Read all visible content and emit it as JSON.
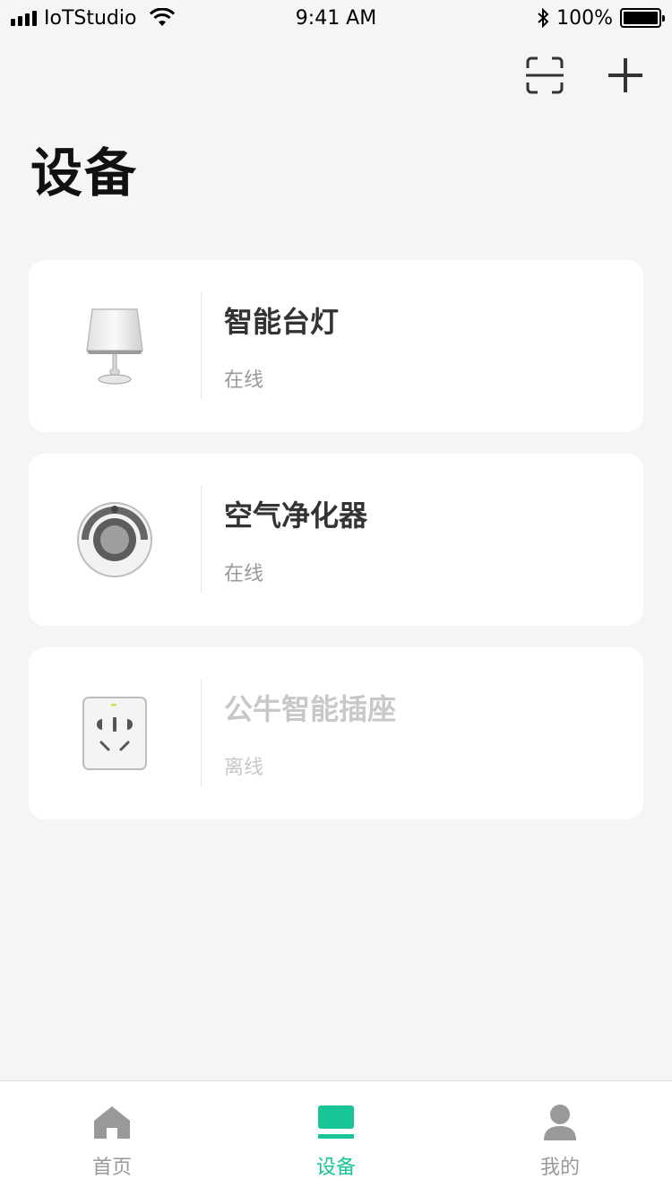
{
  "status_bar": {
    "carrier": "IoTStudio",
    "time": "9:41 AM",
    "battery": "100%",
    "icons": [
      "signal-icon",
      "wifi-icon",
      "bluetooth-icon",
      "battery-icon"
    ]
  },
  "header": {
    "title": "设备",
    "actions": [
      "scan-icon",
      "add-icon"
    ]
  },
  "devices": [
    {
      "name": "智能台灯",
      "status": "在线",
      "online": true,
      "icon": "lamp-icon"
    },
    {
      "name": "空气净化器",
      "status": "在线",
      "online": true,
      "icon": "air-purifier-icon"
    },
    {
      "name": "公牛智能插座",
      "status": "离线",
      "online": false,
      "icon": "socket-icon"
    }
  ],
  "tabs": [
    {
      "label": "首页",
      "icon": "home-icon",
      "active": false
    },
    {
      "label": "设备",
      "icon": "device-icon",
      "active": true
    },
    {
      "label": "我的",
      "icon": "user-icon",
      "active": false
    }
  ],
  "colors": {
    "accent": "#18c596",
    "background": "#f5f5f5",
    "card": "#ffffff",
    "offline_text": "#c8c8c8"
  }
}
